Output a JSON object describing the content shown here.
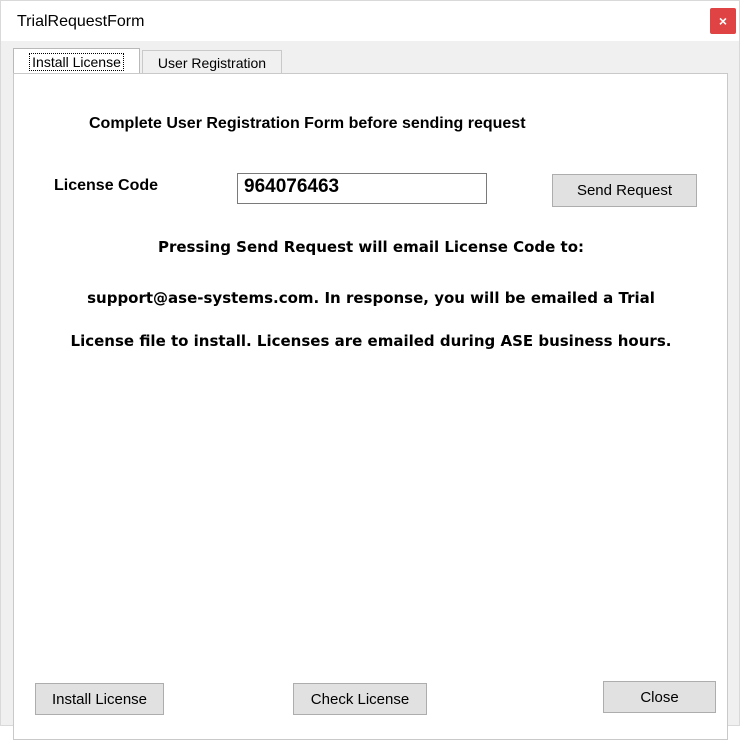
{
  "window": {
    "title": "TrialRequestForm",
    "close_glyph": "×"
  },
  "tabs": [
    {
      "label": "Install License",
      "active": true
    },
    {
      "label": "User Registration",
      "active": false
    }
  ],
  "install_tab": {
    "heading": "Complete User Registration Form before sending request",
    "license_code_label": "License Code",
    "license_code_value": "964076463",
    "send_request_label": "Send Request",
    "message_lines": [
      "Pressing Send Request will email License Code to:",
      "support@ase-systems.com. In response, you will be emailed a Trial",
      "License file to install. Licenses are emailed during ASE business hours."
    ]
  },
  "footer": {
    "install_license_label": "Install License",
    "check_license_label": "Check License",
    "close_label": "Close"
  },
  "colors": {
    "close_button_bg": "#e04343",
    "window_bg": "#f0f0f0",
    "panel_bg": "#ffffff"
  }
}
